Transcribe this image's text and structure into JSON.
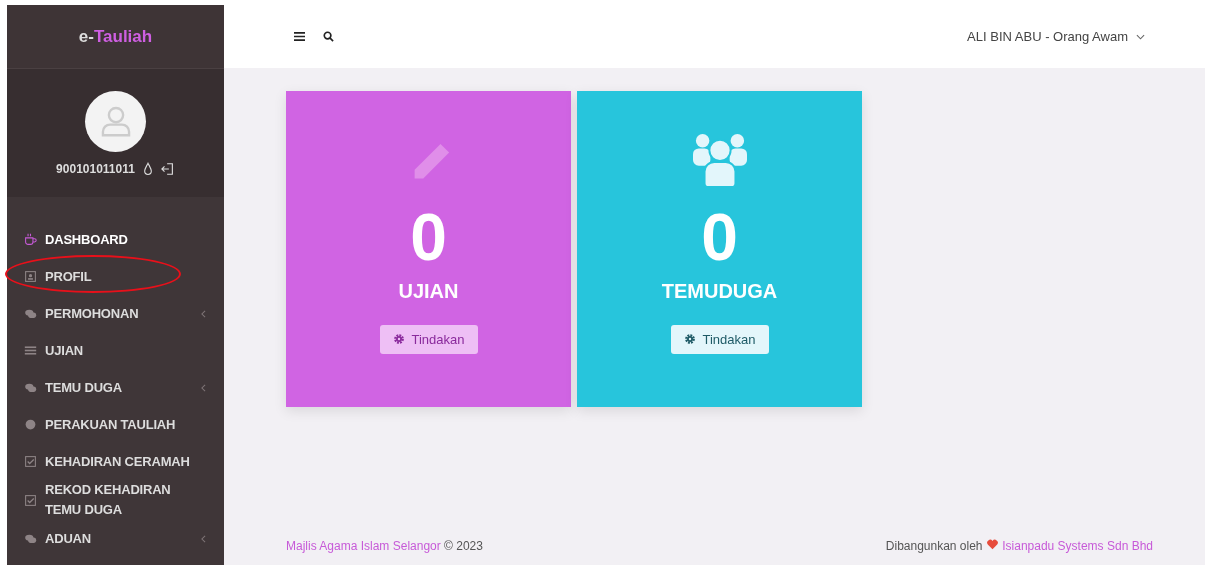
{
  "sidebar": {
    "brand": {
      "prefix": "e-",
      "name": "Tauliah"
    },
    "user": {
      "id": "900101011011"
    },
    "items": [
      {
        "label": "DASHBOARD",
        "selected": true,
        "expandable": false
      },
      {
        "label": "PROFIL",
        "selected": false,
        "expandable": false,
        "annotated": true
      },
      {
        "label": "PERMOHONAN",
        "selected": false,
        "expandable": true
      },
      {
        "label": "UJIAN",
        "selected": false,
        "expandable": false
      },
      {
        "label": "TEMU DUGA",
        "selected": false,
        "expandable": true
      },
      {
        "label": "PERAKUAN TAULIAH",
        "selected": false,
        "expandable": false
      },
      {
        "label": "KEHADIRAN CERAMAH",
        "selected": false,
        "expandable": false
      },
      {
        "label": "REKOD KEHADIRAN TEMU DUGA",
        "selected": false,
        "expandable": false
      },
      {
        "label": "ADUAN",
        "selected": false,
        "expandable": true
      }
    ]
  },
  "header": {
    "user_menu": "ALI BIN ABU - Orang Awam"
  },
  "cards": [
    {
      "count": "0",
      "title": "UJIAN",
      "button": "Tindakan",
      "color": "#d064e3"
    },
    {
      "count": "0",
      "title": "TEMUDUGA",
      "button": "Tindakan",
      "color": "#27c5dc"
    }
  ],
  "footer": {
    "org": "Majlis Agama Islam Selangor",
    "copyright": "© 2023",
    "built_by": "Dibangunkan oleh",
    "company": "Isianpadu Systems Sdn Bhd"
  }
}
